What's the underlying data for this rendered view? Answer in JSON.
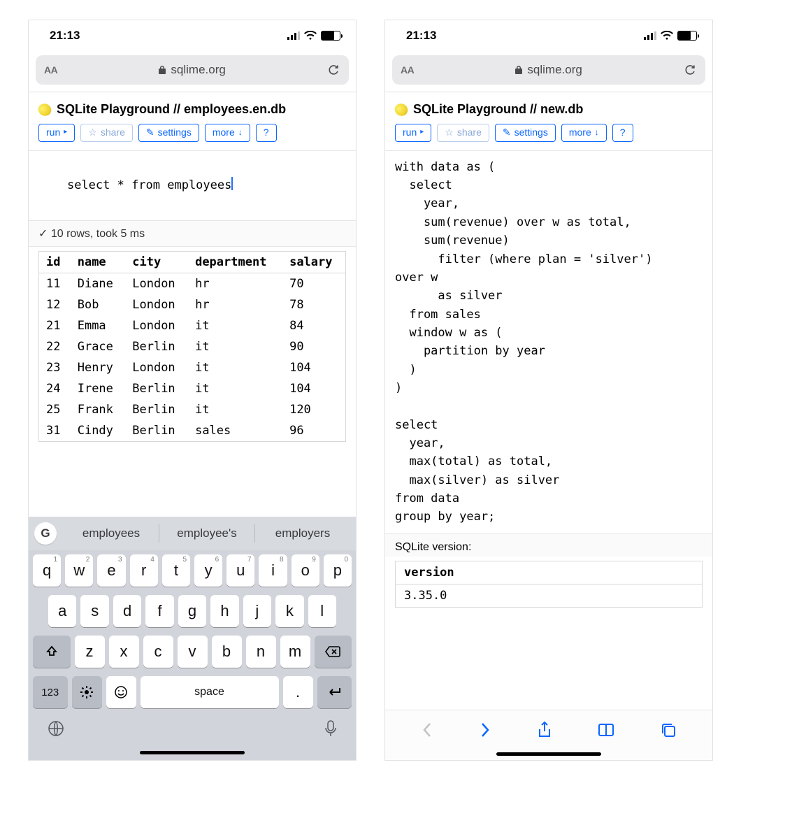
{
  "left": {
    "status_time": "21:13",
    "url_aa": "AA",
    "url_host": "sqlime.org",
    "heading": "SQLite Playground // employees.en.db",
    "toolbar": {
      "run": "run",
      "share": "share",
      "settings": "settings",
      "more": "more",
      "help": "?"
    },
    "editor": "select * from employees",
    "result_status": "10 rows, took 5 ms",
    "columns": [
      "id",
      "name",
      "city",
      "department",
      "salary"
    ],
    "rows": [
      [
        "11",
        "Diane",
        "London",
        "hr",
        "70"
      ],
      [
        "12",
        "Bob",
        "London",
        "hr",
        "78"
      ],
      [
        "21",
        "Emma",
        "London",
        "it",
        "84"
      ],
      [
        "22",
        "Grace",
        "Berlin",
        "it",
        "90"
      ],
      [
        "23",
        "Henry",
        "London",
        "it",
        "104"
      ],
      [
        "24",
        "Irene",
        "Berlin",
        "it",
        "104"
      ],
      [
        "25",
        "Frank",
        "Berlin",
        "it",
        "120"
      ],
      [
        "31",
        "Cindy",
        "Berlin",
        "sales",
        "96"
      ]
    ],
    "suggestions": [
      "employees",
      "employee's",
      "employers"
    ],
    "kb_row1": [
      "q",
      "w",
      "e",
      "r",
      "t",
      "y",
      "u",
      "i",
      "o",
      "p"
    ],
    "kb_row1_nums": [
      "1",
      "2",
      "3",
      "4",
      "5",
      "6",
      "7",
      "8",
      "9",
      "0"
    ],
    "kb_row2": [
      "a",
      "s",
      "d",
      "f",
      "g",
      "h",
      "j",
      "k",
      "l"
    ],
    "kb_row3": [
      "z",
      "x",
      "c",
      "v",
      "b",
      "n",
      "m"
    ],
    "kb_toggles": {
      "numbers": "123",
      "space": "space",
      "dot": "."
    }
  },
  "right": {
    "status_time": "21:13",
    "url_aa": "AA",
    "url_host": "sqlime.org",
    "heading": "SQLite Playground // new.db",
    "toolbar": {
      "run": "run",
      "share": "share",
      "settings": "settings",
      "more": "more",
      "help": "?"
    },
    "editor": "with data as (\n  select\n    year,\n    sum(revenue) over w as total,\n    sum(revenue)\n      filter (where plan = 'silver')\nover w\n      as silver\n  from sales\n  window w as (\n    partition by year\n  )\n)\n\nselect\n  year,\n  max(total) as total,\n  max(silver) as silver\nfrom data\ngroup by year;",
    "version_label": "SQLite version:",
    "version_header": "version",
    "version_value": "3.35.0"
  }
}
